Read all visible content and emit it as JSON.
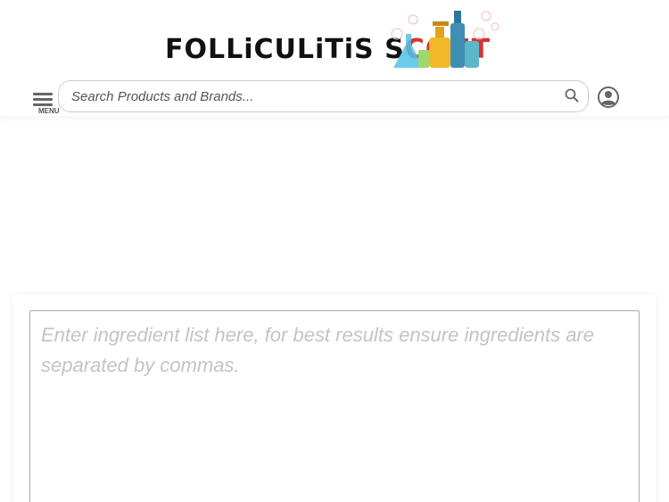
{
  "logo": {
    "text_main": "FOLLiCULiTiS S",
    "text_accent": "COUT",
    "bottles_icon": "bottles-illustration"
  },
  "header": {
    "menu_label": "MENU",
    "menu_icon": "hamburger-icon",
    "search": {
      "placeholder": "Search Products and Brands...",
      "value": "",
      "icon": "search-icon"
    },
    "account_icon": "user-avatar-icon"
  },
  "ingredient_checker": {
    "placeholder": "Enter ingredient list here, for best results ensure ingredients are separated by commas.",
    "value": ""
  },
  "colors": {
    "logo_accent": "#d83232",
    "border": "#cccccc",
    "placeholder": "#c4c4c4"
  }
}
